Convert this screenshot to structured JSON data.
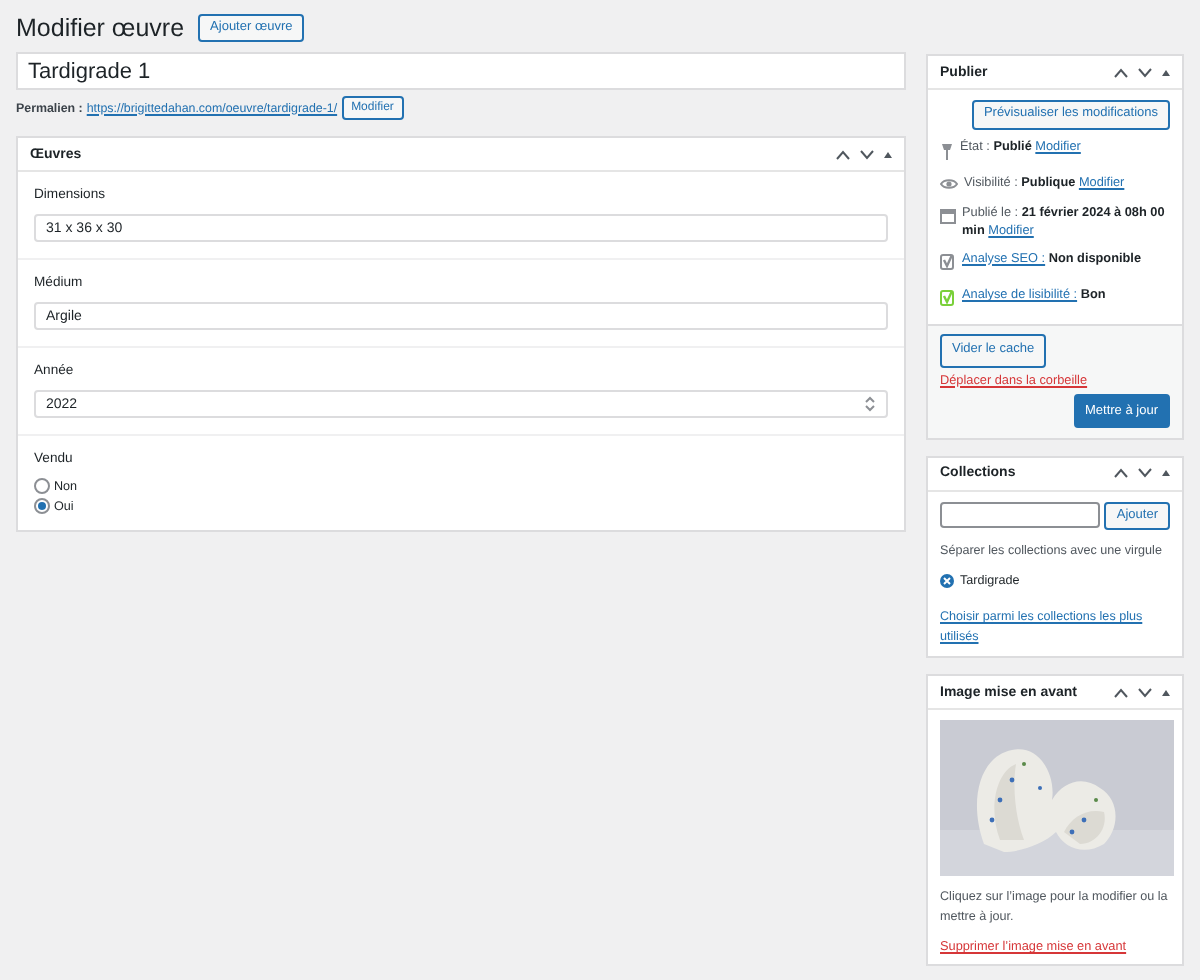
{
  "header": {
    "title": "Modifier œuvre",
    "add_button": "Ajouter œuvre"
  },
  "post_title": "Tardigrade 1",
  "permalink": {
    "label": "Permalien :",
    "url": "https://brigittedahan.com/oeuvre/tardigrade-1/",
    "button": "Modifier"
  },
  "main_panel": {
    "title": "Œuvres",
    "fields": [
      {
        "kind": "text",
        "label": "Dimensions",
        "value": "31 x 36 x 30"
      },
      {
        "kind": "text",
        "label": "Médium",
        "value": "Argile"
      },
      {
        "kind": "number",
        "label": "Année",
        "value": "2022"
      },
      {
        "kind": "radio",
        "label": "Vendu",
        "options": [
          {
            "label": "Non",
            "selected": false
          },
          {
            "label": "Oui",
            "selected": true
          }
        ]
      }
    ]
  },
  "publish": {
    "title": "Publier",
    "preview_button": "Prévisualiser les modifications",
    "rows": [
      {
        "kind": "status",
        "label": "État :",
        "value": "Publié",
        "link": "Modifier"
      },
      {
        "kind": "visibility",
        "label": "Visibilité :",
        "value": "Publique",
        "link": "Modifier"
      },
      {
        "kind": "date",
        "label": "Publié le :",
        "value": "21 février 2024 à 08h 00 min",
        "link": "Modifier"
      },
      {
        "kind": "seo",
        "link": "Analyse SEO :",
        "value": "Non disponible"
      },
      {
        "kind": "readability",
        "link": "Analyse de lisibilité :",
        "value": "Bon"
      }
    ],
    "cache_button": "Vider le cache",
    "trash_link": "Déplacer dans la corbeille",
    "update_button": "Mettre à jour"
  },
  "collections": {
    "title": "Collections",
    "add_button": "Ajouter",
    "hint": "Séparer les collections avec une virgule",
    "tags": [
      "Tardigrade"
    ],
    "choose_link": "Choisir parmi les collections les plus utilisés"
  },
  "featured_image": {
    "title": "Image mise en avant",
    "hint": "Cliquez sur l’image pour la modifier ou la mettre à jour.",
    "remove_link": "Supprimer l’image mise en avant"
  }
}
